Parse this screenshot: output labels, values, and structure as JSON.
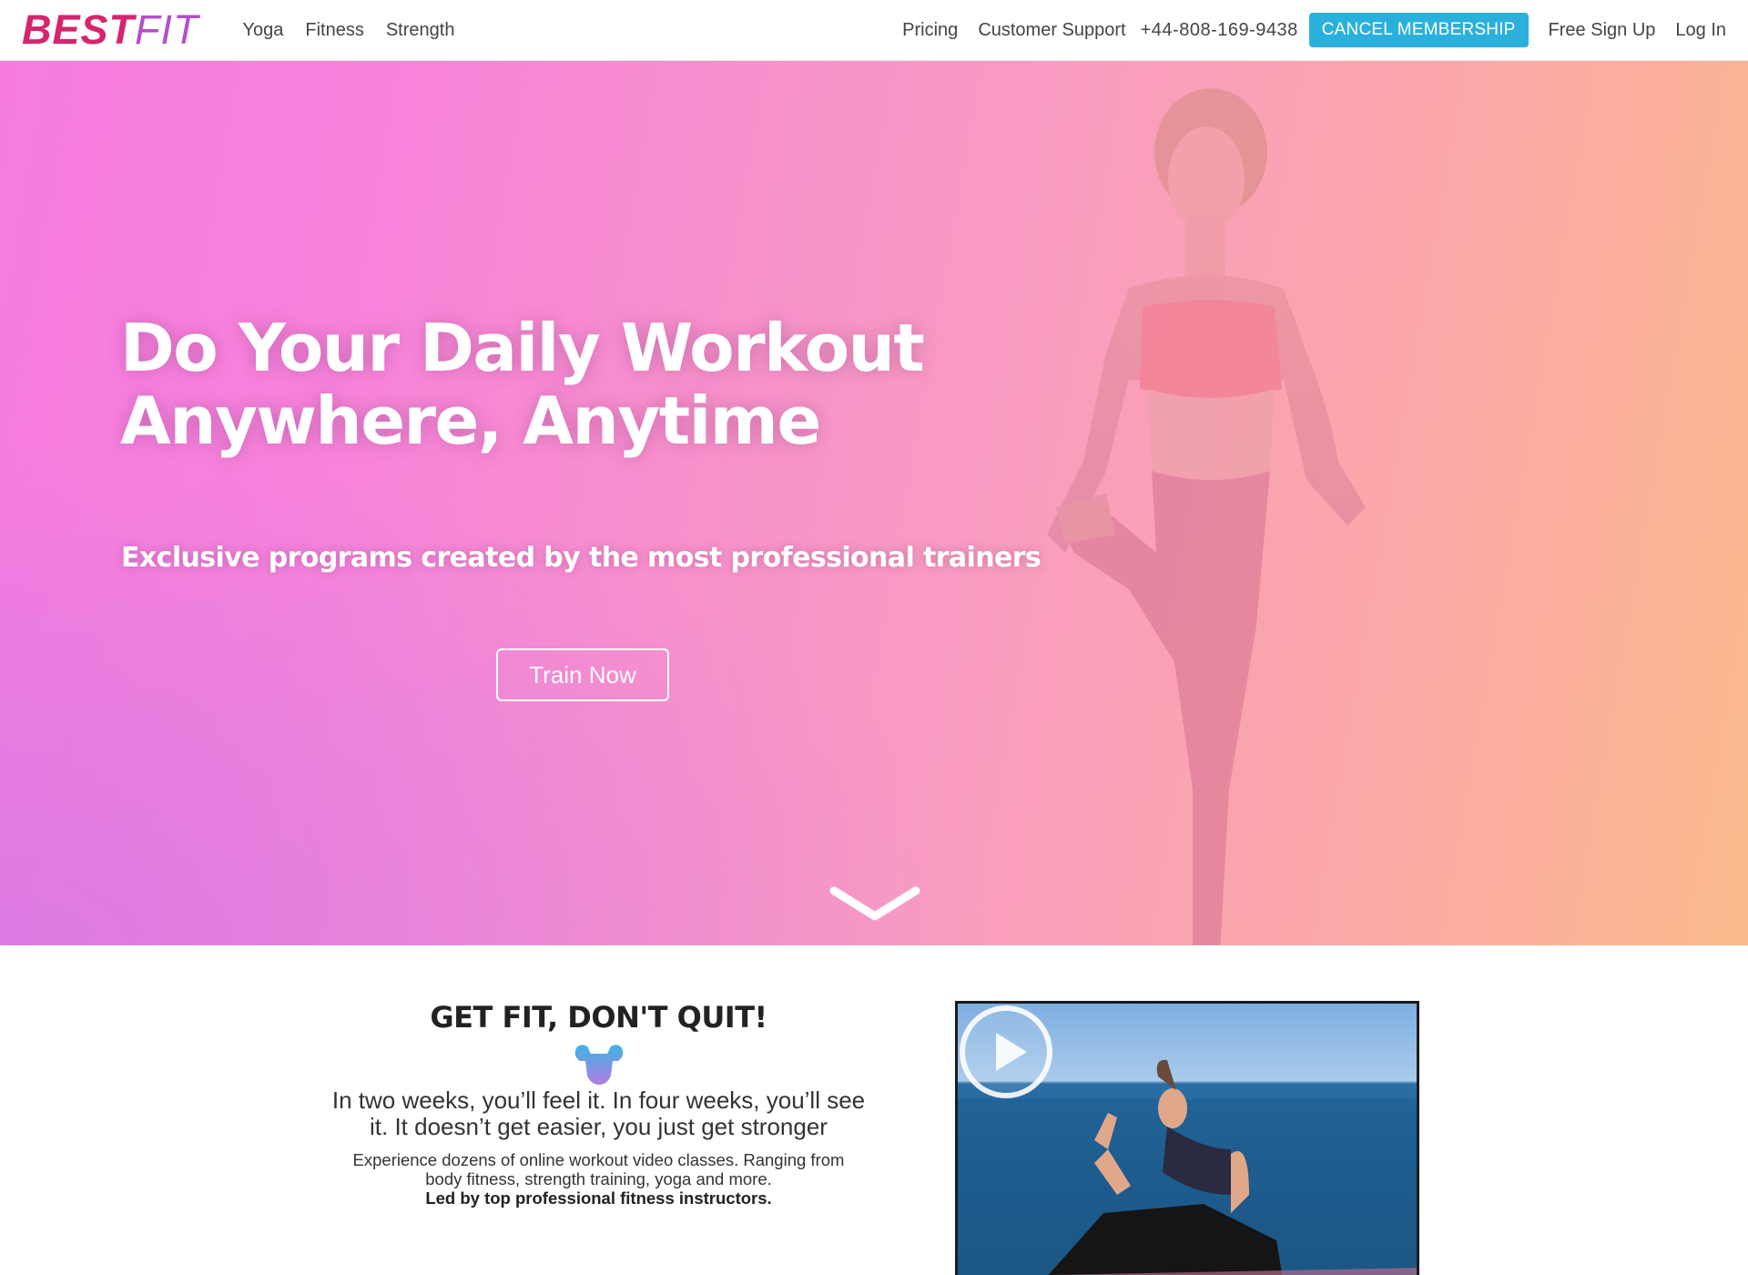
{
  "header": {
    "logo": {
      "part1": "BEST",
      "part2": "FIT"
    },
    "nav_left": [
      "Yoga",
      "Fitness",
      "Strength"
    ],
    "nav_right": {
      "pricing": "Pricing",
      "support": "Customer Support",
      "phone": "+44-808-169-9438",
      "cancel": "CANCEL MEMBERSHIP",
      "signup": "Free Sign Up",
      "login": "Log In"
    }
  },
  "hero": {
    "title_line1": "Do Your Daily Workout",
    "title_line2": "Anywhere, Anytime",
    "subtitle": "Exclusive programs created by the most professional trainers",
    "cta": "Train Now",
    "scroll_icon": "chevron-down-icon"
  },
  "section": {
    "title": "GET FIT, DON'T QUIT!",
    "icon": "muscle-icon",
    "lead": "In two weeks, you’ll feel it. In four weeks, you’ll see it. It doesn’t get easier, you just get stronger",
    "body": "Experience dozens of online workout video classes. Ranging from body fitness, strength training, yoga and more.",
    "body_bold": "Led by top professional fitness instructors.",
    "video_icon": "play-icon"
  },
  "colors": {
    "brand_pink": "#d6246e",
    "brand_purple": "#b44fc9",
    "cancel_button": "#2bb0dc",
    "hero_gradient": [
      "#f57be0",
      "#f99bc2",
      "#fcba8c"
    ]
  }
}
